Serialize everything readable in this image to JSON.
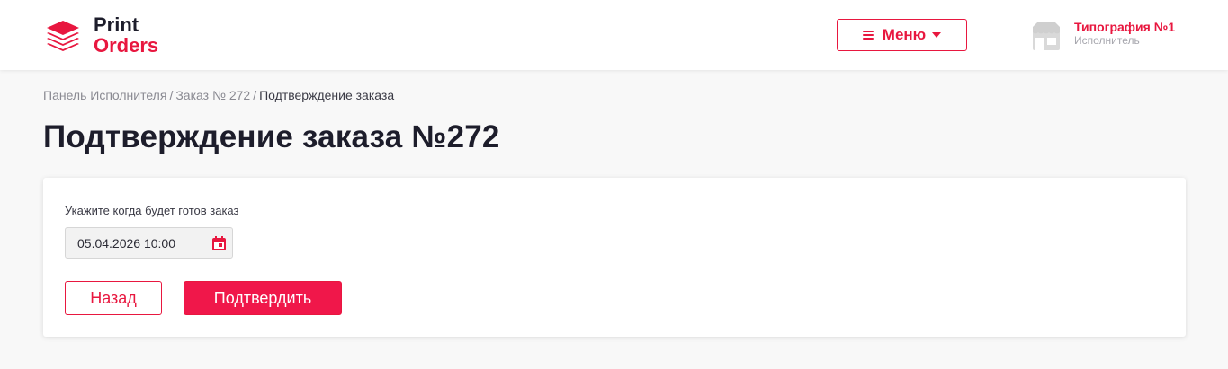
{
  "header": {
    "logo": {
      "top": "Print",
      "bottom": "Orders"
    },
    "menu": {
      "label": "Меню"
    },
    "user": {
      "name": "Типография №1",
      "role": "Исполнитель"
    }
  },
  "breadcrumb": {
    "items": [
      "Панель Исполнителя",
      "Заказ № 272"
    ],
    "current": "Подтверждение заказа",
    "separator": "/"
  },
  "page": {
    "title": "Подтверждение заказа №272"
  },
  "form": {
    "label": "Укажите когда будет готов заказ",
    "date_value": "05.04.2026 10:00",
    "back_label": "Назад",
    "confirm_label": "Подтвердить"
  },
  "colors": {
    "accent": "#e8173f",
    "background": "#f8f8f8",
    "card": "#ffffff"
  },
  "icons": [
    "layers-logo-icon",
    "hamburger-icon",
    "caret-down-icon",
    "shop-icon",
    "calendar-icon"
  ]
}
